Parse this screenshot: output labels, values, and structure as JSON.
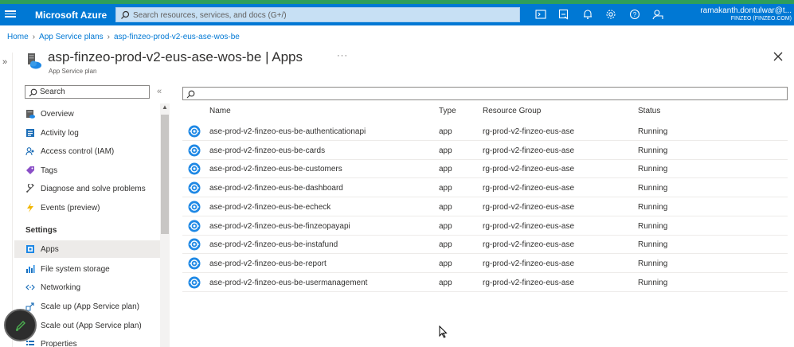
{
  "colors": {
    "accent": "#0078d4",
    "topbar_stripe": "#2e9e5a",
    "app_icon": "#1e88e5"
  },
  "topbar": {
    "brand": "Microsoft Azure",
    "search_placeholder": "Search resources, services, and docs (G+/)",
    "icons": [
      "cloud-shell-icon",
      "directory-filter-icon",
      "notifications-icon",
      "settings-icon",
      "help-icon",
      "feedback-icon"
    ],
    "account_name": "ramakanth.dontulwar@t...",
    "account_org": "FINZEO (FINZEO.COM)"
  },
  "breadcrumb": [
    "Home",
    "App Service plans",
    "asp-finzeo-prod-v2-eus-ase-wos-be"
  ],
  "blade": {
    "title": "asp-finzeo-prod-v2-eus-ase-wos-be | Apps",
    "subtitle": "App Service plan",
    "more": "···"
  },
  "menu": {
    "search_placeholder": "Search",
    "items_top": [
      {
        "label": "Overview",
        "icon": "overview-icon"
      },
      {
        "label": "Activity log",
        "icon": "activity-log-icon"
      },
      {
        "label": "Access control (IAM)",
        "icon": "iam-icon"
      },
      {
        "label": "Tags",
        "icon": "tag-icon"
      },
      {
        "label": "Diagnose and solve problems",
        "icon": "wrench-icon"
      },
      {
        "label": "Events (preview)",
        "icon": "lightning-icon"
      }
    ],
    "section_settings": "Settings",
    "items_settings": [
      {
        "label": "Apps",
        "icon": "apps-icon",
        "active": true
      },
      {
        "label": "File system storage",
        "icon": "storage-icon"
      },
      {
        "label": "Networking",
        "icon": "networking-icon"
      },
      {
        "label": "Scale up (App Service plan)",
        "icon": "scale-up-icon"
      },
      {
        "label": "Scale out (App Service plan)",
        "icon": "scale-out-icon"
      },
      {
        "label": "Properties",
        "icon": "properties-icon"
      }
    ]
  },
  "table": {
    "filter_placeholder": "",
    "columns": [
      "Name",
      "Type",
      "Resource Group",
      "Status"
    ],
    "rows": [
      {
        "name": "ase-prod-v2-finzeo-eus-be-authenticationapi",
        "type": "app",
        "rg": "rg-prod-v2-finzeo-eus-ase",
        "status": "Running"
      },
      {
        "name": "ase-prod-v2-finzeo-eus-be-cards",
        "type": "app",
        "rg": "rg-prod-v2-finzeo-eus-ase",
        "status": "Running"
      },
      {
        "name": "ase-prod-v2-finzeo-eus-be-customers",
        "type": "app",
        "rg": "rg-prod-v2-finzeo-eus-ase",
        "status": "Running"
      },
      {
        "name": "ase-prod-v2-finzeo-eus-be-dashboard",
        "type": "app",
        "rg": "rg-prod-v2-finzeo-eus-ase",
        "status": "Running"
      },
      {
        "name": "ase-prod-v2-finzeo-eus-be-echeck",
        "type": "app",
        "rg": "rg-prod-v2-finzeo-eus-ase",
        "status": "Running"
      },
      {
        "name": "ase-prod-v2-finzeo-eus-be-finzeopayapi",
        "type": "app",
        "rg": "rg-prod-v2-finzeo-eus-ase",
        "status": "Running"
      },
      {
        "name": "ase-prod-v2-finzeo-eus-be-instafund",
        "type": "app",
        "rg": "rg-prod-v2-finzeo-eus-ase",
        "status": "Running"
      },
      {
        "name": "ase-prod-v2-finzeo-eus-be-report",
        "type": "app",
        "rg": "rg-prod-v2-finzeo-eus-ase",
        "status": "Running"
      },
      {
        "name": "ase-prod-v2-finzeo-eus-be-usermanagement",
        "type": "app",
        "rg": "rg-prod-v2-finzeo-eus-ase",
        "status": "Running"
      }
    ]
  }
}
